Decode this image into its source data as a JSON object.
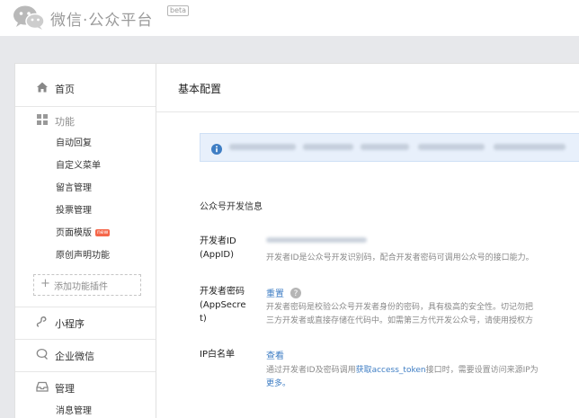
{
  "header": {
    "logo_text": "微信·公众平台",
    "beta_badge": "beta"
  },
  "sidebar": {
    "home": "首页",
    "functions": {
      "label": "功能",
      "items": [
        "自动回复",
        "自定义菜单",
        "留言管理",
        "投票管理",
        "页面模版",
        "原创声明功能"
      ],
      "new_badge": "new"
    },
    "add_plugin": "添加功能插件",
    "mini_program": "小程序",
    "enterprise_wechat": "企业微信",
    "management": {
      "label": "管理",
      "items": [
        "消息管理"
      ]
    }
  },
  "main": {
    "title": "基本配置",
    "section_heading": "公众号开发信息",
    "fields": [
      {
        "label_line1": "开发者ID",
        "label_line2": "(AppID)",
        "description": "开发者ID是公众号开发识别码，配合开发者密码可调用公众号的接口能力。"
      },
      {
        "label_line1": "开发者密码",
        "label_line2": "(AppSecre",
        "label_line3": "t)",
        "action": "重置",
        "desc_line1": "开发者密码是校验公众号开发者身份的密码，具有极高的安全性。切记勿把",
        "desc_line2": "三方开发者或直接存储在代码中。如需第三方代开发公众号，请使用授权方"
      },
      {
        "label_line1": "IP白名单",
        "action": "查看",
        "desc_pre": "通过开发者ID及密码调用",
        "desc_link": "获取access_token",
        "desc_post": "接口时，需要设置访问来源IP为",
        "desc_line2": "更多。"
      }
    ]
  },
  "colors": {
    "link": "#3f7ec4",
    "notice_bg": "#e8f0fb",
    "page_bg": "#e7e8eb",
    "new_badge": "#f5674a"
  }
}
